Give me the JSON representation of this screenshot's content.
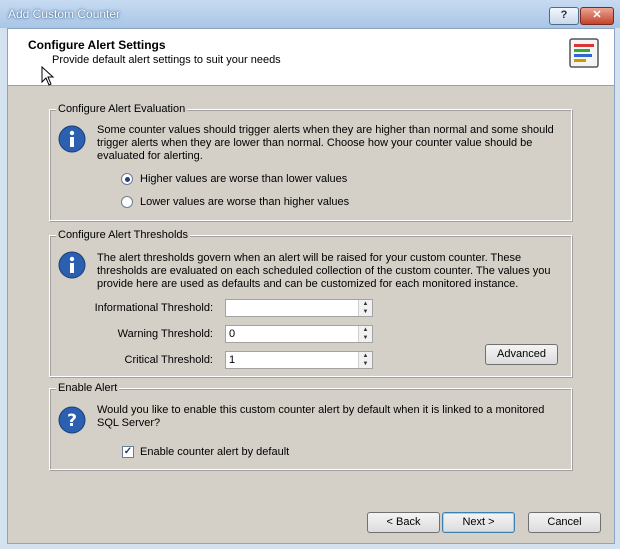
{
  "window": {
    "title": "Add Custom Counter",
    "help_label": "?",
    "close_label": "✕"
  },
  "header": {
    "title": "Configure Alert Settings",
    "subtitle": "Provide default alert settings to suit your needs",
    "icon": "chart-report-icon"
  },
  "evaluation": {
    "group_label": "Configure Alert Evaluation",
    "description": "Some counter values should trigger alerts when they are higher than normal and some should trigger alerts when they are lower than normal. Choose how your counter value should be evaluated for alerting.",
    "options": [
      {
        "label": "Higher values are worse than lower values",
        "selected": true
      },
      {
        "label": "Lower values are worse than higher values",
        "selected": false
      }
    ]
  },
  "thresholds": {
    "group_label": "Configure Alert Thresholds",
    "description": "The alert thresholds govern when an alert will be raised for your custom counter. These thresholds are evaluated on each scheduled collection of the custom counter. The values you provide here are used as defaults and can be customized for each monitored instance.",
    "fields": [
      {
        "label": "Informational Threshold:",
        "value": ""
      },
      {
        "label": "Warning Threshold:",
        "value": "0"
      },
      {
        "label": "Critical Threshold:",
        "value": "1"
      }
    ],
    "advanced_label": "Advanced"
  },
  "enable_alert": {
    "group_label": "Enable Alert",
    "description": "Would you like to enable this custom counter alert by default when it is linked to a monitored SQL Server?",
    "checkbox_label": "Enable counter alert by default",
    "checked": true
  },
  "footer": {
    "back_label": "< Back",
    "next_label": "Next >",
    "cancel_label": "Cancel"
  },
  "colors": {
    "accent": "#24408b",
    "dialog_bg": "#d4d0c8",
    "title_bar": "#a9c5e6"
  }
}
